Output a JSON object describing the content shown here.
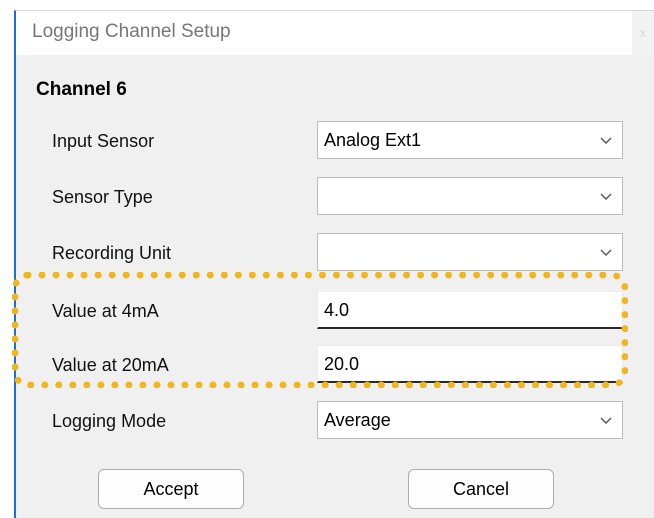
{
  "window": {
    "title": "Logging Channel Setup",
    "close_glyph": "x"
  },
  "channel": {
    "title": "Channel 6"
  },
  "fields": {
    "input_sensor": {
      "label": "Input Sensor",
      "value": "Analog Ext1"
    },
    "sensor_type": {
      "label": "Sensor Type",
      "value": ""
    },
    "recording_unit": {
      "label": "Recording Unit",
      "value": ""
    },
    "value_4ma": {
      "label": "Value at 4mA",
      "value": "4.0"
    },
    "value_20ma": {
      "label": "Value at 20mA",
      "value": "20.0"
    },
    "logging_mode": {
      "label": "Logging Mode",
      "value": "Average"
    }
  },
  "buttons": {
    "accept": "Accept",
    "cancel": "Cancel"
  },
  "colors": {
    "highlight": "#f2b51c",
    "window_border": "#1f6fd1",
    "dialog_bg": "#f0f0f0"
  },
  "icons": {
    "dropdown": "chevron-down-icon",
    "close": "close-icon"
  }
}
